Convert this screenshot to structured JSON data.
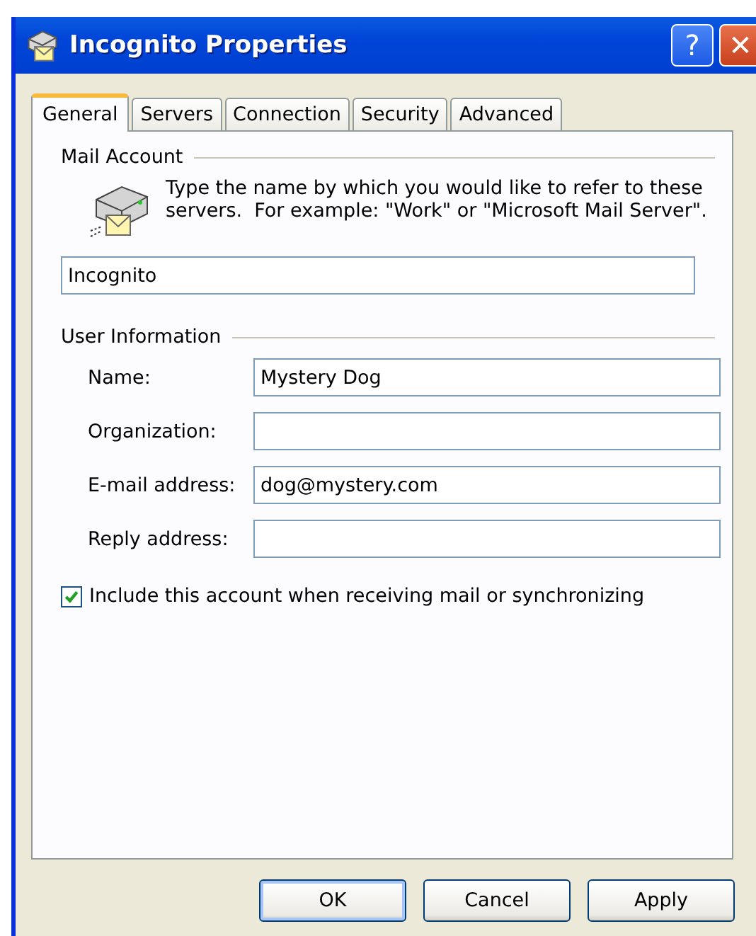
{
  "window": {
    "title": "Incognito Properties"
  },
  "title_buttons": [
    {
      "kind": "help",
      "label": "?"
    },
    {
      "kind": "close",
      "label": "✕"
    }
  ],
  "tabs": [
    {
      "label": "General",
      "selected": true
    },
    {
      "label": "Servers",
      "selected": false
    },
    {
      "label": "Connection",
      "selected": false
    },
    {
      "label": "Security",
      "selected": false
    },
    {
      "label": "Advanced",
      "selected": false
    }
  ],
  "mail_account": {
    "heading": "Mail Account",
    "description": "Type the name by which you would like to refer to these servers.  For example: \"Work\" or \"Microsoft Mail Server\".",
    "value": "Incognito"
  },
  "user_information": {
    "heading": "User Information",
    "fields": [
      {
        "label": "Name:",
        "value": "Mystery Dog"
      },
      {
        "label": "Organization:"
      },
      {
        "label": "E-mail address:",
        "value": "dog@mystery.com"
      },
      {
        "label": "Reply address:"
      }
    ]
  },
  "include_option": {
    "label": "Include this account when receiving mail or synchronizing",
    "checked": true
  },
  "buttons": [
    {
      "label": "OK",
      "default": true
    },
    {
      "label": "Cancel",
      "default": false
    },
    {
      "label": "Apply",
      "default": false
    }
  ]
}
